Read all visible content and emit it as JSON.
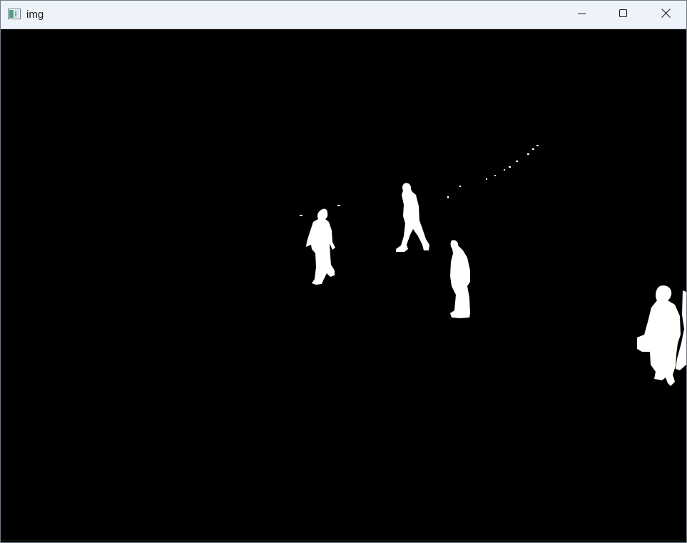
{
  "window": {
    "title": "img",
    "icon": "image-window-icon",
    "controls": {
      "minimize_icon": "minimize-icon",
      "maximize_icon": "maximize-icon",
      "close_icon": "close-icon"
    }
  },
  "image": {
    "kind": "binary-mask",
    "background_color": "#000000",
    "foreground_color": "#ffffff"
  }
}
